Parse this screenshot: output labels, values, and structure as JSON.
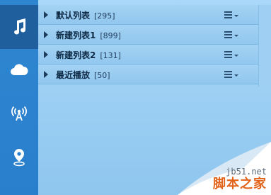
{
  "sidebar": {
    "items": [
      {
        "icon": "music-note-icon",
        "active": true
      },
      {
        "icon": "cloud-icon",
        "active": false
      },
      {
        "icon": "radio-broadcast-icon",
        "active": false
      },
      {
        "icon": "location-pin-icon",
        "active": false
      }
    ]
  },
  "playlists": [
    {
      "label": "默认列表",
      "count": "[295]"
    },
    {
      "label": "新建列表1",
      "count": "[899]"
    },
    {
      "label": "新建列表2",
      "count": "[131]"
    },
    {
      "label": "最近播放",
      "count": "[50]"
    }
  ],
  "watermark": {
    "url": "jb51.net",
    "name": "脚本之家"
  },
  "colors": {
    "sidebar": "#2a7fcc",
    "sidebar_active": "#1f5f9e",
    "panel": "#a3d2f4",
    "brand": "#e2641c"
  }
}
